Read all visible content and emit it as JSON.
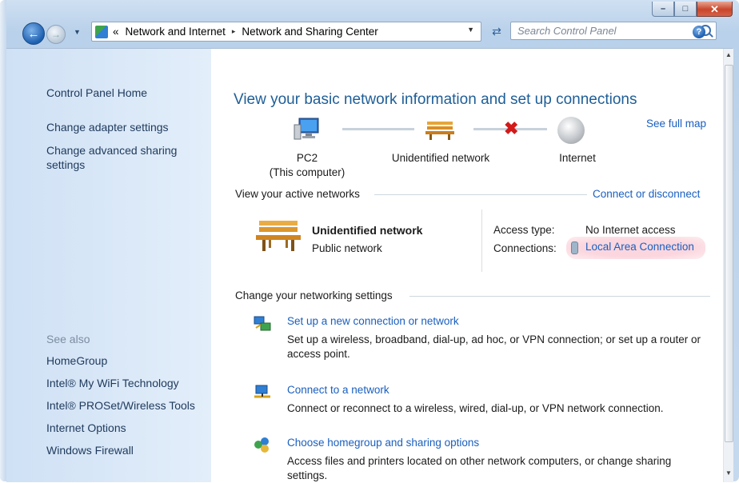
{
  "window": {
    "caption_buttons": {
      "minimize": "–",
      "maximize": "□",
      "close": "✕"
    }
  },
  "address_bar": {
    "overflow": "«",
    "crumbs": [
      "Network and Internet",
      "Network and Sharing Center"
    ],
    "separator": "▸"
  },
  "search": {
    "placeholder": "Search Control Panel"
  },
  "sidebar": {
    "top_links": [
      "Control Panel Home",
      "Change adapter settings",
      "Change advanced sharing settings"
    ],
    "see_also_label": "See also",
    "see_also": [
      "HomeGroup",
      "Intel® My WiFi Technology",
      "Intel® PROSet/Wireless Tools",
      "Internet Options",
      "Windows Firewall"
    ]
  },
  "main": {
    "title": "View your basic network information and set up connections",
    "see_full_map": "See full map",
    "map": {
      "computer_label": "PC2",
      "computer_sub": "(This computer)",
      "network_label": "Unidentified network",
      "internet_label": "Internet"
    },
    "active": {
      "header": "View your active networks",
      "connect_link": "Connect or disconnect",
      "network_name": "Unidentified network",
      "network_type": "Public network",
      "access_type_label": "Access type:",
      "access_type_value": "No Internet access",
      "connections_label": "Connections:",
      "connections_value": "Local Area Connection"
    },
    "settings": {
      "header": "Change your networking settings",
      "tasks": [
        {
          "link": "Set up a new connection or network",
          "desc": "Set up a wireless, broadband, dial-up, ad hoc, or VPN connection; or set up a router or access point."
        },
        {
          "link": "Connect to a network",
          "desc": "Connect or reconnect to a wireless, wired, dial-up, or VPN network connection."
        },
        {
          "link": "Choose homegroup and sharing options",
          "desc": "Access files and printers located on other network computers, or change sharing settings."
        }
      ]
    },
    "help_glyph": "?"
  }
}
